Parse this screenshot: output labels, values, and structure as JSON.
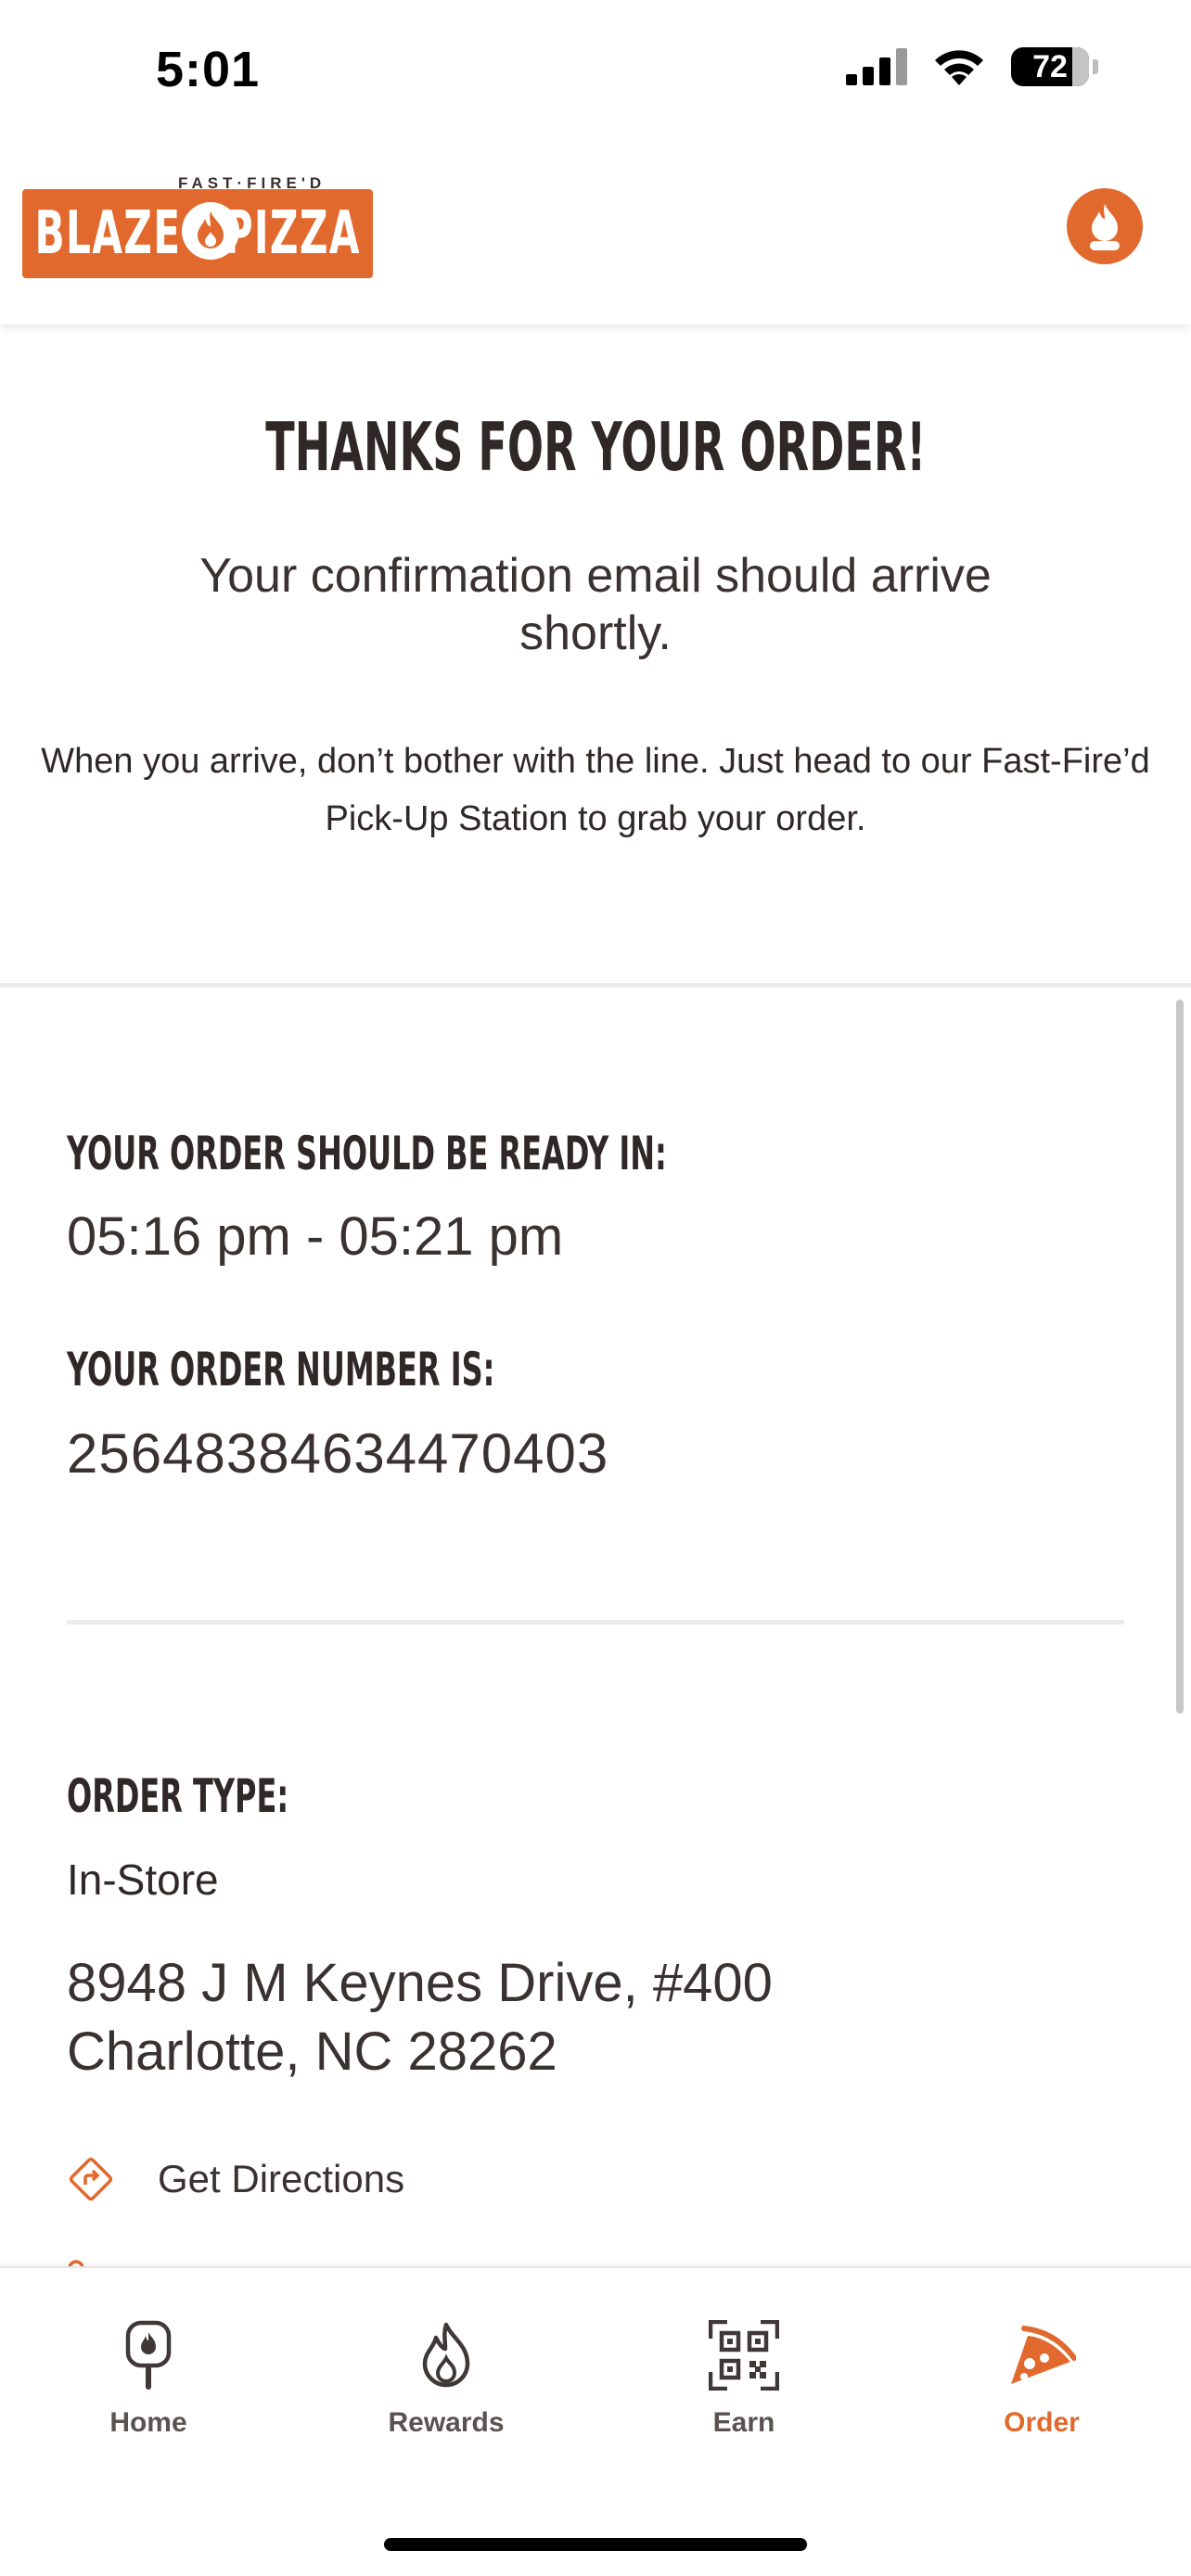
{
  "status_bar": {
    "time": "5:01",
    "battery": "72"
  },
  "header": {
    "logo_tagline": "FAST·FIRE'D",
    "logo_left": "BLAZE",
    "logo_right": "PIZZA"
  },
  "confirmation": {
    "title": "THANKS FOR YOUR ORDER!",
    "email_notice": "Your confirmation email should arrive shortly.",
    "pickup_instructions": "When you arrive, don’t bother with the line. Just head to our Fast-Fire’d Pick-Up Station to grab your order."
  },
  "order": {
    "ready_label": "YOUR ORDER SHOULD BE READY IN:",
    "ready_window": "05:16 pm - 05:21 pm",
    "number_label": "YOUR ORDER NUMBER IS:",
    "number": "25648384634470403",
    "type_label": "ORDER TYPE:",
    "type": "In-Store",
    "address_line1": "8948 J M Keynes Drive, #400",
    "address_line2": "Charlotte, NC 28262",
    "directions_label": "Get Directions"
  },
  "tabs": [
    {
      "label": "Home",
      "icon": "pizza-peel-icon",
      "active": false
    },
    {
      "label": "Rewards",
      "icon": "flame-icon",
      "active": false
    },
    {
      "label": "Earn",
      "icon": "qr-code-icon",
      "active": false
    },
    {
      "label": "Order",
      "icon": "pizza-slice-icon",
      "active": true
    }
  ],
  "colors": {
    "brand_orange": "#e1692d",
    "text_dark": "#2f2826",
    "divider": "#ebebeb"
  }
}
